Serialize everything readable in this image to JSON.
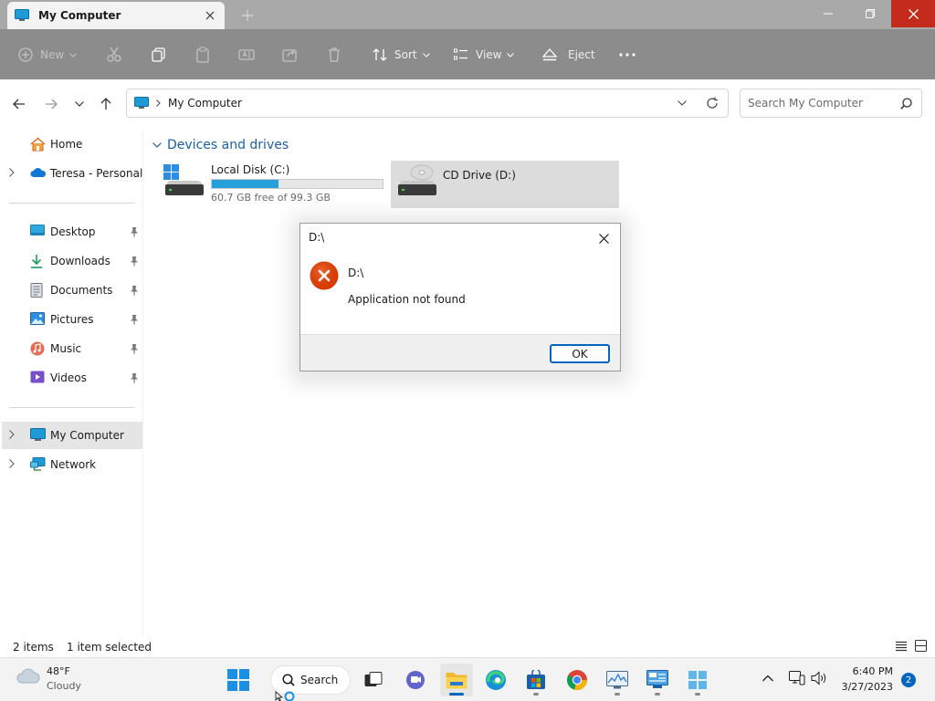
{
  "window": {
    "tab_title": "My Computer",
    "accent": "#c42b1c"
  },
  "commands": {
    "new_label": "New",
    "sort_label": "Sort",
    "view_label": "View",
    "eject_label": "Eject"
  },
  "address": {
    "crumb": "My Computer",
    "search_placeholder": "Search My Computer"
  },
  "sidebar": {
    "items": [
      {
        "label": "Home",
        "icon": "home-icon"
      },
      {
        "label": "Teresa - Personal",
        "icon": "onedrive-icon"
      },
      {
        "label": "Desktop",
        "icon": "desktop-icon",
        "pinned": true
      },
      {
        "label": "Downloads",
        "icon": "downloads-icon",
        "pinned": true
      },
      {
        "label": "Documents",
        "icon": "documents-icon",
        "pinned": true
      },
      {
        "label": "Pictures",
        "icon": "pictures-icon",
        "pinned": true
      },
      {
        "label": "Music",
        "icon": "music-icon",
        "pinned": true
      },
      {
        "label": "Videos",
        "icon": "videos-icon",
        "pinned": true
      },
      {
        "label": "My Computer",
        "icon": "computer-icon",
        "selected": true
      },
      {
        "label": "Network",
        "icon": "network-icon"
      }
    ]
  },
  "content": {
    "group_title": "Devices and drives",
    "drives": [
      {
        "label": "Local Disk (C:)",
        "free_text": "60.7 GB free of 99.3 GB",
        "used_fraction": 0.39
      },
      {
        "label": "CD Drive (D:)",
        "selected": true
      }
    ]
  },
  "status": {
    "item_count": "2 items",
    "selection": "1 item selected"
  },
  "dialog": {
    "title": "D:\\",
    "path": "D:\\",
    "message": "Application not found",
    "ok_label": "OK",
    "error_color": "#d83b01"
  },
  "taskbar": {
    "weather_temp": "48°F",
    "weather_desc": "Cloudy",
    "search_label": "Search",
    "time": "6:40 PM",
    "date": "3/27/2023",
    "notification_count": "2"
  }
}
